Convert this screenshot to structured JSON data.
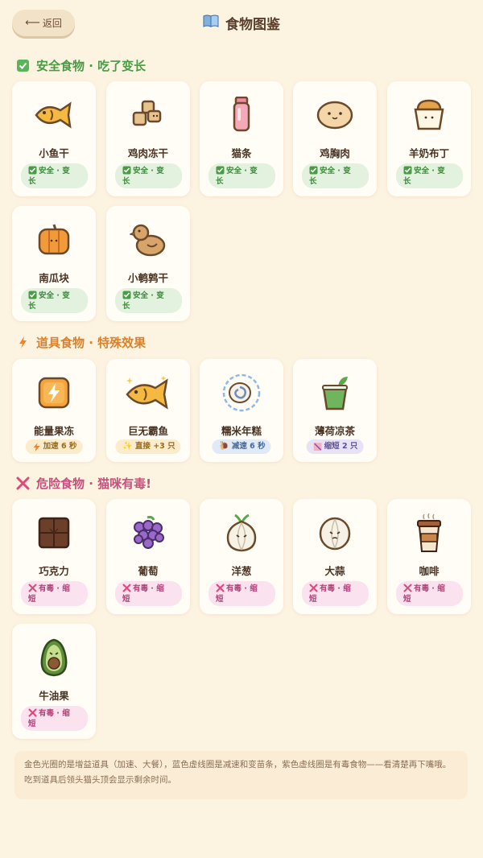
{
  "header": {
    "back_label": "返回",
    "title": "食物图鉴"
  },
  "sections": {
    "safe": {
      "title": "安全食物 · 吃了变长",
      "items": [
        {
          "name": "小鱼干",
          "tag_line1": "安全 · 变",
          "tag_line2": "长",
          "icon": "small-fish-icon"
        },
        {
          "name": "鸡肉冻干",
          "tag_line1": "安全 · 变",
          "tag_line2": "长",
          "icon": "freeze-dried-chicken-icon"
        },
        {
          "name": "猫条",
          "tag_line1": "安全 · 变",
          "tag_line2": "长",
          "icon": "cat-treat-tube-icon"
        },
        {
          "name": "鸡胸肉",
          "tag_line1": "安全 · 变",
          "tag_line2": "长",
          "icon": "chicken-breast-icon"
        },
        {
          "name": "羊奶布丁",
          "tag_line1": "安全 · 变",
          "tag_line2": "长",
          "icon": "goat-milk-pudding-icon"
        },
        {
          "name": "南瓜块",
          "tag_line1": "安全 · 变",
          "tag_line2": "长",
          "icon": "pumpkin-icon"
        },
        {
          "name": "小鹌鹑干",
          "tag_line1": "安全 · 变",
          "tag_line2": "长",
          "icon": "quail-icon"
        }
      ]
    },
    "power": {
      "title": "道具食物 · 特殊效果",
      "items": [
        {
          "name": "能量果冻",
          "tag": "加速 6 秒",
          "tag_icon": "lightning-icon",
          "icon": "energy-jelly-icon"
        },
        {
          "name": "巨无霸鱼",
          "tag": "直接 +3 只",
          "tag_icon": "sparkle-icon",
          "icon": "giant-fish-icon"
        },
        {
          "name": "糯米年糕",
          "tag": "减速 6 秒",
          "tag_icon": "snail-icon",
          "icon": "rice-cake-icon"
        },
        {
          "name": "薄荷凉茶",
          "tag": "缩短 2 只",
          "tag_icon": "shrink-icon",
          "icon": "mint-tea-icon"
        }
      ]
    },
    "danger": {
      "title": "危险食物 · 猫咪有毒!",
      "items": [
        {
          "name": "巧克力",
          "tag_line1": "有毒 · 缩",
          "tag_line2": "短",
          "icon": "chocolate-icon"
        },
        {
          "name": "葡萄",
          "tag_line1": "有毒 · 缩",
          "tag_line2": "短",
          "icon": "grapes-icon"
        },
        {
          "name": "洋葱",
          "tag_line1": "有毒 · 缩",
          "tag_line2": "短",
          "icon": "onion-icon"
        },
        {
          "name": "大蒜",
          "tag_line1": "有毒 · 缩",
          "tag_line2": "短",
          "icon": "garlic-icon"
        },
        {
          "name": "咖啡",
          "tag_line1": "有毒 · 缩",
          "tag_line2": "短",
          "icon": "coffee-icon"
        },
        {
          "name": "牛油果",
          "tag_line1": "有毒 · 缩",
          "tag_line2": "短",
          "icon": "avocado-icon"
        }
      ]
    }
  },
  "note": "金色光圈的是增益道具（加速、大餐），蓝色虚线圈是减速和变苗条，紫色虚线圈是有毒食物——看清楚再下嘴哦。吃到道具后领头猫头顶会显示剩余时间。",
  "colors": {
    "background": "#fdf3e1",
    "safe": "#4a9b45",
    "power": "#d9822b",
    "danger": "#c94f7c"
  }
}
